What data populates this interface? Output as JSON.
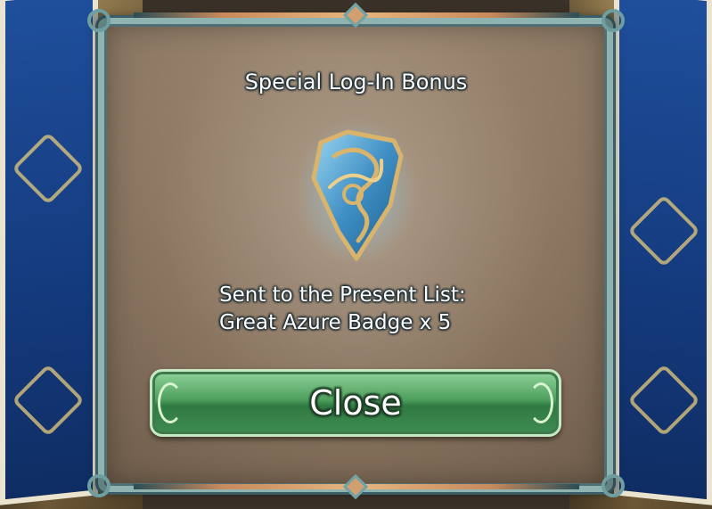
{
  "dialog": {
    "title": "Special Log-In Bonus",
    "reward_icon": "great-azure-badge-icon",
    "message_line1": "Sent to the Present List:",
    "message_line2": "Great Azure Badge x 5",
    "close_label": "Close"
  },
  "colors": {
    "frame": "#8fb3b0",
    "frame_dark": "#3b5e66",
    "panel": "#8a7560",
    "button_green": "#4e9f5d",
    "banner_blue": "#1f4f9c",
    "badge_blue": "#4fa3d6",
    "badge_gold": "#d9b46a"
  }
}
